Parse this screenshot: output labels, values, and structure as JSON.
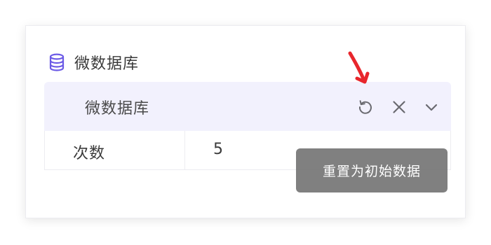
{
  "section": {
    "title": "微数据库",
    "icon": "database-icon",
    "accent_color": "#6b5ae6"
  },
  "panel": {
    "header_title": "微数据库",
    "header_bg": "#f2f1fd",
    "actions": [
      {
        "name": "reset",
        "icon": "reset-icon"
      },
      {
        "name": "close",
        "icon": "close-icon"
      },
      {
        "name": "collapse",
        "icon": "chevron-down-icon"
      }
    ]
  },
  "table": {
    "rows": [
      {
        "key": "次数",
        "value": "5"
      }
    ]
  },
  "tooltip": {
    "text": "重置为初始数据"
  },
  "annotation": {
    "icon": "red-arrow-icon",
    "color": "#e8262c"
  }
}
